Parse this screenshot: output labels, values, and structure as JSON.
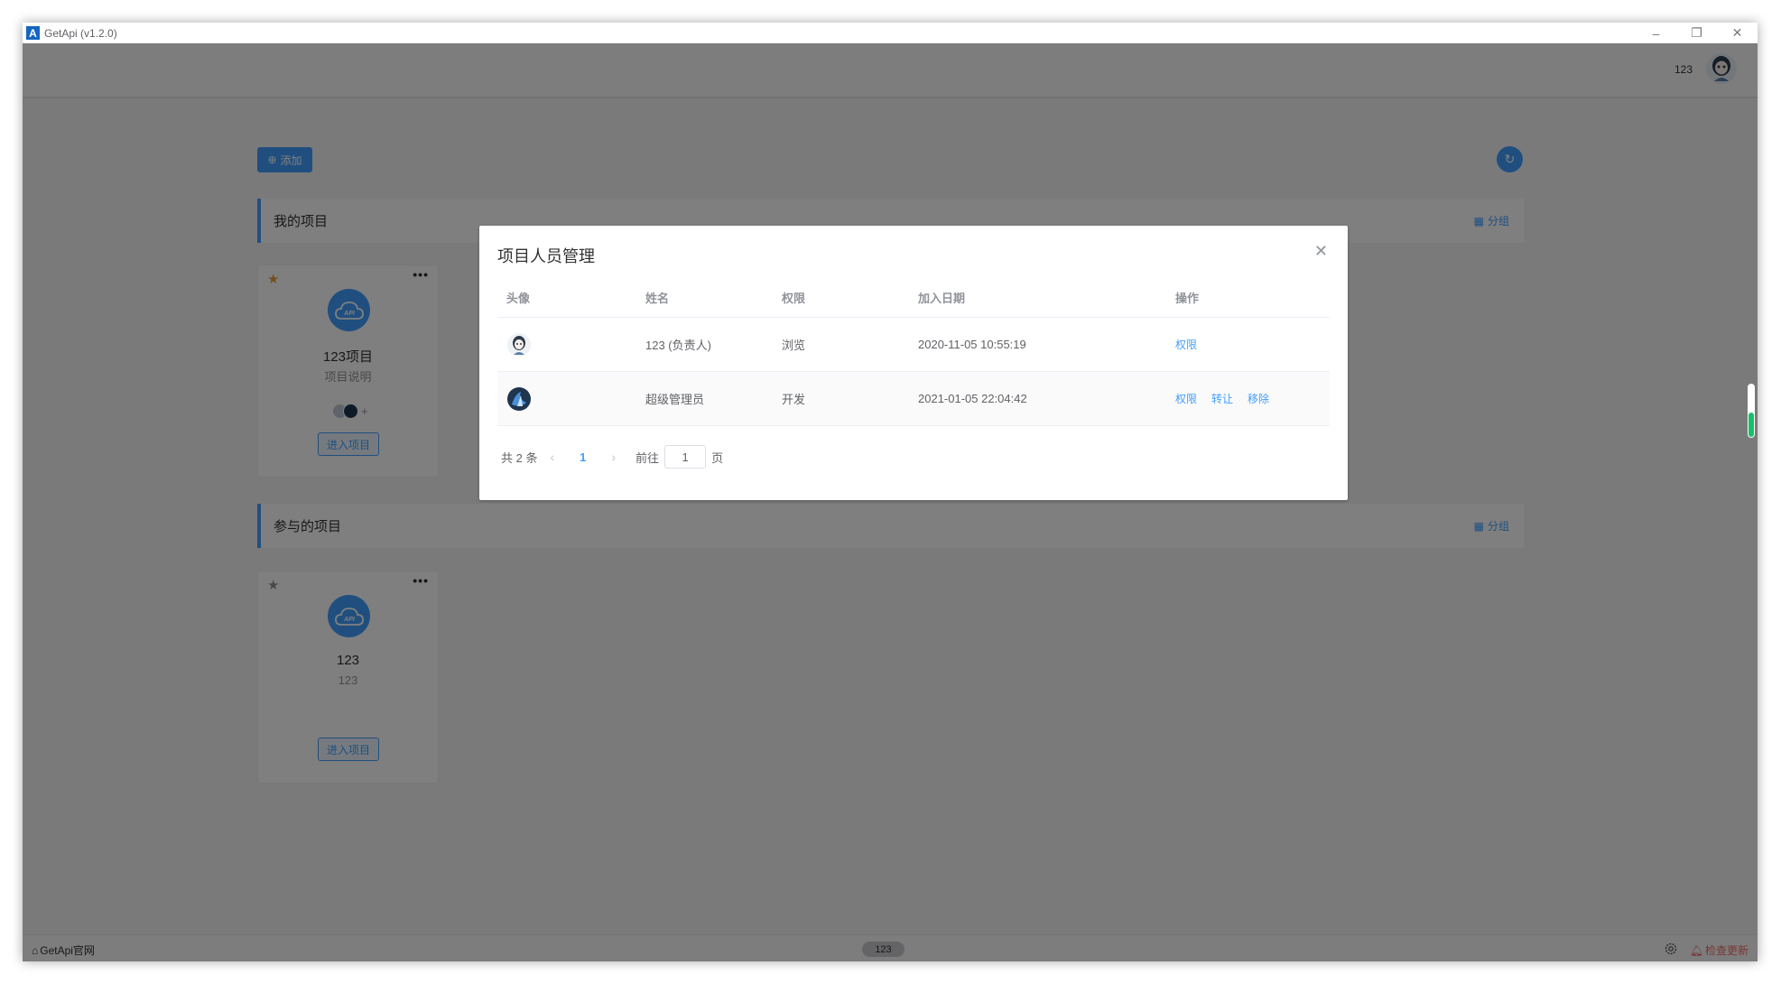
{
  "window": {
    "title": "GetApi (v1.2.0)",
    "logo_letter": "A",
    "controls": [
      "–",
      "❐",
      "✕"
    ]
  },
  "header": {
    "user_name": "123"
  },
  "toolbar": {
    "add_label": "添加"
  },
  "sections": {
    "mine": {
      "title": "我的项目",
      "group_label": "分组"
    },
    "joined": {
      "title": "参与的项目",
      "group_label": "分组"
    }
  },
  "projects": {
    "mine": [
      {
        "name": "123项目",
        "description": "项目说明",
        "enter_label": "进入项目",
        "starred": true
      }
    ],
    "joined": [
      {
        "name": "123",
        "description": "123",
        "enter_label": "进入项目",
        "starred": false
      }
    ]
  },
  "footer": {
    "home_label": "GetApi官网",
    "version_badge": "123",
    "update_label": "检查更新"
  },
  "dialog": {
    "title": "项目人员管理",
    "columns": [
      "头像",
      "姓名",
      "权限",
      "加入日期",
      "操作"
    ],
    "rows": [
      {
        "name": "123 (负责人)",
        "permission": "浏览",
        "joined": "2020-11-05 10:55:19",
        "actions": [
          "权限"
        ]
      },
      {
        "name": "超级管理员",
        "permission": "开发",
        "joined": "2021-01-05 22:04:42",
        "actions": [
          "权限",
          "转让",
          "移除"
        ]
      }
    ],
    "pagination": {
      "total_text": "共 2 条",
      "current_page": "1",
      "goto_label": "前往",
      "goto_value": "1",
      "page_suffix": "页"
    }
  },
  "colors": {
    "primary": "#409eff",
    "star_active": "#e6a23c",
    "star_inactive": "#909399",
    "danger": "#f56c6c",
    "indicator": "#19be6b"
  },
  "indicator_level": 0.47
}
